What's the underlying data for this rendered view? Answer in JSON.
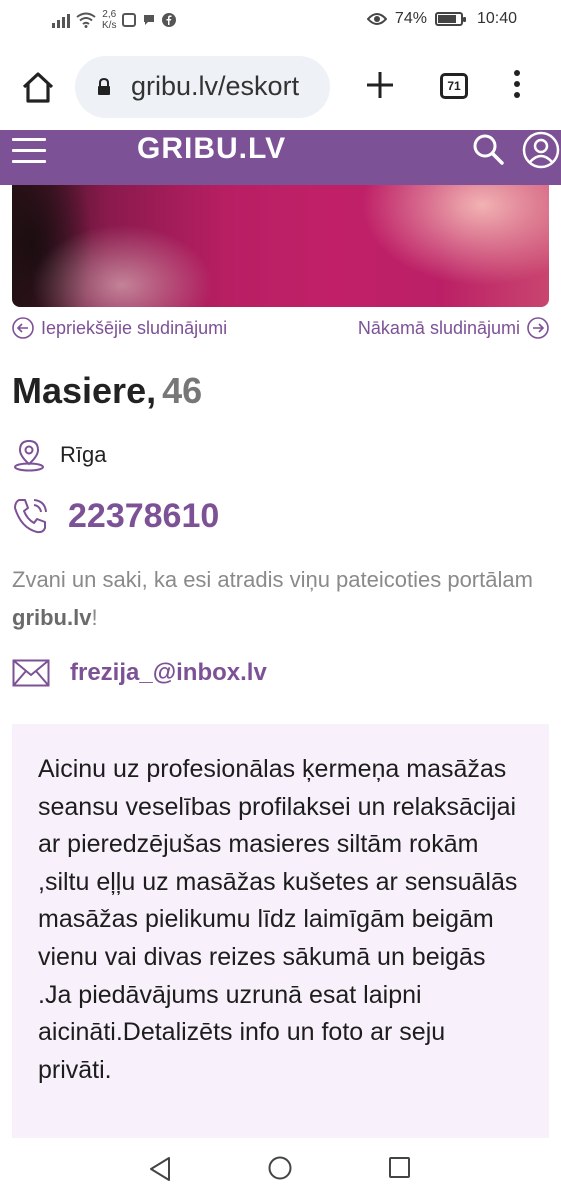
{
  "status_bar": {
    "net_speed_value": "2,6",
    "net_speed_unit": "K/s",
    "battery_percent": "74%",
    "battery_level": 0.74,
    "time": "10:40"
  },
  "browser": {
    "url": "gribu.lv/eskort",
    "tab_count": "71"
  },
  "site": {
    "logo": "GRIBU.LV",
    "accent_color": "#7d5196"
  },
  "nav": {
    "prev_label": "Iepriekšējie sludinājumi",
    "next_label": "Nākamā sludinājumi"
  },
  "profile": {
    "name": "Masiere,",
    "age": "46",
    "city": "Rīga",
    "phone": "22378610",
    "hint_prefix": "Zvani un saki, ka esi atradis viņu pateicoties portālam",
    "hint_site": "gribu.lv",
    "hint_suffix": "!",
    "email": "frezija_@inbox.lv",
    "description": "Aicinu uz profesionālas ķermeņa masāžas seansu veselības profilaksei un relaksācijai ar pieredzējušas masieres siltām rokām ,siltu eļļu uz masāžas kušetes ar sensuālās masāžas pielikumu līdz laimīgām beigām vienu vai divas reizes sākumā un beigās .Ja piedāvājums uzrunā esat laipni aicināti.Detalizēts info un foto ar seju privāti."
  }
}
